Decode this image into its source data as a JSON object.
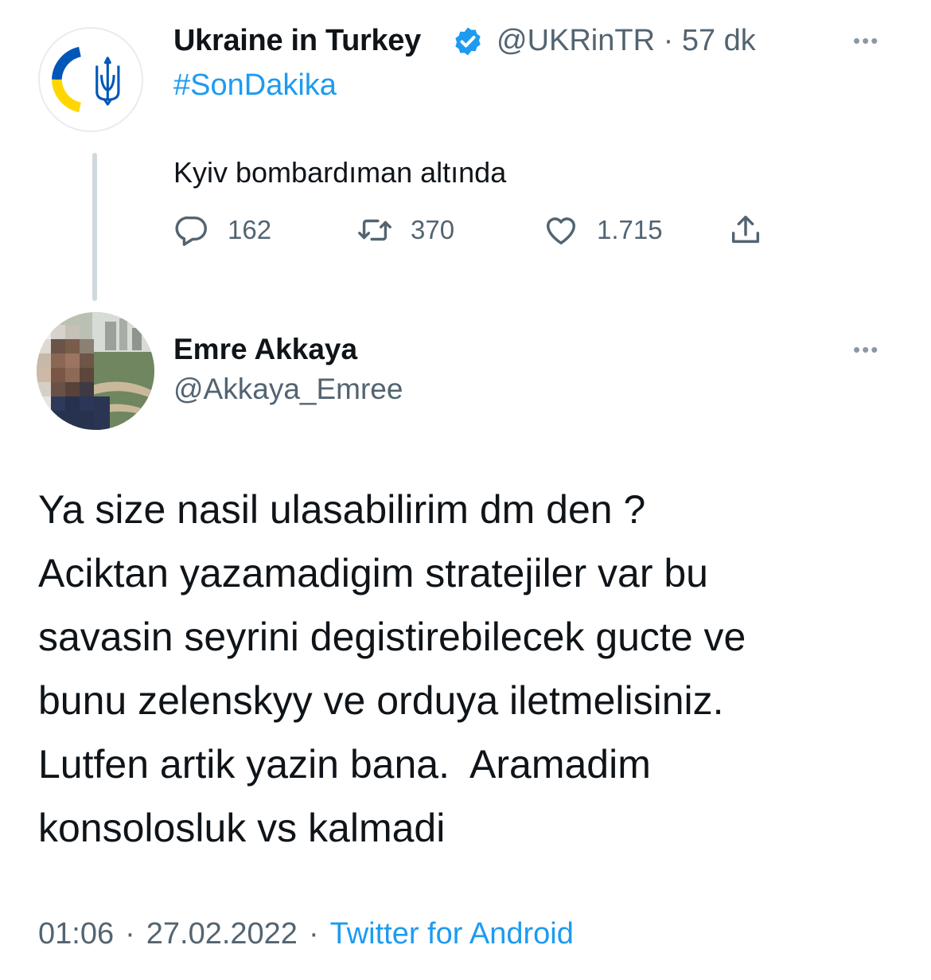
{
  "parent_tweet": {
    "display_name": "Ukraine in Turkey",
    "handle": "@UKRinTR",
    "separator": "·",
    "time_ago": "57 dk",
    "hashtag": "#SonDakika",
    "text": "Kyiv bombardıman altında",
    "counts": {
      "replies": "162",
      "retweets": "370",
      "likes": "1.715"
    },
    "colors": {
      "flag_blue": "#0057b7",
      "flag_yellow": "#ffd700",
      "verified": "#1d9bf0"
    }
  },
  "reply_tweet": {
    "display_name": "Emre Akkaya",
    "handle": "@Akkaya_Emree",
    "text": "Ya size nasil ulasabilirim dm den ?\nAciktan yazamadigim stratejiler var bu\nsavasin seyrini degistirebilecek gucte ve\nbunu zelenskyy ve orduya iletmelisiniz.\nLutfen artik yazin bana.  Aramadim\nkonsolosluk vs kalmadi",
    "time": "01:06",
    "date": "27.02.2022",
    "separator": "·",
    "source": "Twitter for Android"
  },
  "icons": [
    "verified-badge-icon",
    "more-options-icon",
    "reply-icon",
    "retweet-icon",
    "like-icon",
    "share-icon"
  ]
}
